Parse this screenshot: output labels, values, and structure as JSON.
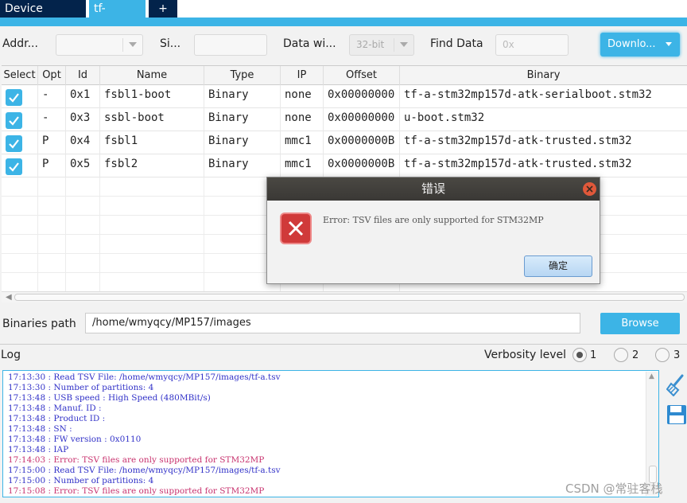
{
  "tabs": [
    {
      "label": "Device memory"
    },
    {
      "label": "tf-a.tsv",
      "close": "✕"
    },
    {
      "label": "+"
    }
  ],
  "toolbar": {
    "address_label": "Addr...",
    "size_label": "Si...",
    "data_width_label": "Data wi...",
    "data_width_value": "32-bit",
    "find_data_label": "Find Data",
    "find_data_placeholder": "0x",
    "download_label": "Downlo..."
  },
  "table": {
    "columns": [
      "Select",
      "Opt",
      "Id",
      "Name",
      "Type",
      "IP",
      "Offset",
      "Binary"
    ],
    "rows": [
      {
        "checked": true,
        "opt": "-",
        "id": "0x1",
        "name": "fsbl1-boot",
        "type": "Binary",
        "ip": "none",
        "offset": "0x00000000",
        "binary": "tf-a-stm32mp157d-atk-serialboot.stm32"
      },
      {
        "checked": true,
        "opt": "-",
        "id": "0x3",
        "name": "ssbl-boot",
        "type": "Binary",
        "ip": "none",
        "offset": "0x00000000",
        "binary": "u-boot.stm32"
      },
      {
        "checked": true,
        "opt": "P",
        "id": "0x4",
        "name": "fsbl1",
        "type": "Binary",
        "ip": "mmc1",
        "offset": "0x0000000B",
        "binary": "tf-a-stm32mp157d-atk-trusted.stm32"
      },
      {
        "checked": true,
        "opt": "P",
        "id": "0x5",
        "name": "fsbl2",
        "type": "Binary",
        "ip": "mmc1",
        "offset": "0x0000000B",
        "binary": "tf-a-stm32mp157d-atk-trusted.stm32"
      }
    ]
  },
  "binaries": {
    "label": "Binaries path",
    "path": "/home/wmyqcy/MP157/images",
    "browse_label": "Browse"
  },
  "log": {
    "label": "Log",
    "verbosity_label": "Verbosity level",
    "levels": [
      "1",
      "2",
      "3"
    ],
    "selected_level": "1",
    "lines": [
      {
        "text": "17:13:30 : Read TSV File: /home/wmyqcy/MP157/images/tf-a.tsv",
        "error": false
      },
      {
        "text": "17:13:30 : Number of partitions: 4",
        "error": false
      },
      {
        "text": "17:13:48 : USB speed : High Speed (480MBit/s)",
        "error": false
      },
      {
        "text": "17:13:48 : Manuf. ID :",
        "error": false
      },
      {
        "text": "17:13:48 : Product ID :",
        "error": false
      },
      {
        "text": "17:13:48 : SN :",
        "error": false
      },
      {
        "text": "17:13:48 : FW version : 0x0110",
        "error": false
      },
      {
        "text": "17:13:48 : IAP",
        "error": false
      },
      {
        "text": "17:14:03 : Error: TSV files are only supported for STM32MP",
        "error": true
      },
      {
        "text": "17:15:00 : Read TSV File: /home/wmyqcy/MP157/images/tf-a.tsv",
        "error": false
      },
      {
        "text": "17:15:00 : Number of partitions: 4",
        "error": false
      },
      {
        "text": "17:15:08 : Error: TSV files are only supported for STM32MP",
        "error": true
      }
    ]
  },
  "dialog": {
    "title": "错误",
    "message": "Error: TSV files are only supported for STM32MP",
    "ok_label": "确定"
  },
  "watermark": "CSDN @常驻客栈",
  "colors": {
    "accent": "#3cb4e6",
    "dark_tab": "#03234b",
    "log_text": "#3232c8",
    "log_error": "#c8326e",
    "error_icon": "#d03a3a"
  }
}
